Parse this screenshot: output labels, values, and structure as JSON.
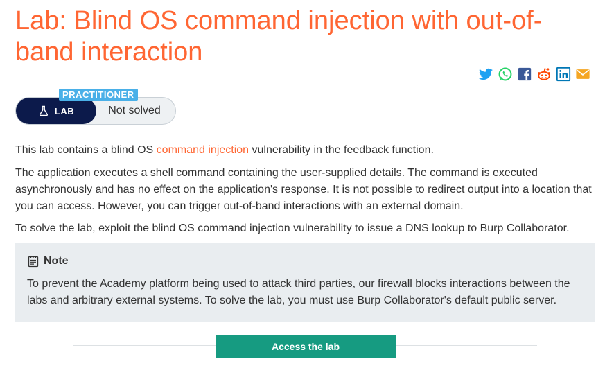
{
  "page": {
    "title": "Lab: Blind OS command injection with out-of-band interaction"
  },
  "share": [
    {
      "icon": "twitter-icon",
      "color": "#1da1f2"
    },
    {
      "icon": "whatsapp-icon",
      "color": "#25d366"
    },
    {
      "icon": "facebook-icon",
      "color": "#3b5998"
    },
    {
      "icon": "reddit-icon",
      "color": "#ff4500"
    },
    {
      "icon": "linkedin-icon",
      "color": "#0077b5"
    },
    {
      "icon": "email-icon",
      "color": "#f5a623"
    }
  ],
  "lab": {
    "level": "PRACTITIONER",
    "label": "LAB",
    "status": "Not solved",
    "level_color": "#4ab0e8",
    "lab_color": "#0c1a4b"
  },
  "description": {
    "p1_before": "This lab contains a blind OS ",
    "p1_link": "command injection",
    "p1_after": " vulnerability in the feedback function.",
    "p2": "The application executes a shell command containing the user-supplied details. The command is executed asynchronously and has no effect on the application's response. It is not possible to redirect output into a location that you can access. However, you can trigger out-of-band interactions with an external domain.",
    "p3": "To solve the lab, exploit the blind OS command injection vulnerability to issue a DNS lookup to Burp Collaborator."
  },
  "note": {
    "icon": "note-icon",
    "title": "Note",
    "body": "To prevent the Academy platform being used to attack third parties, our firewall blocks interactions between the labs and arbitrary external systems. To solve the lab, you must use Burp Collaborator's default public server."
  },
  "action": {
    "access_label": "Access the lab",
    "color": "#169b81"
  },
  "colors": {
    "accent": "#ff6633",
    "note_bg": "#e9edf0"
  }
}
